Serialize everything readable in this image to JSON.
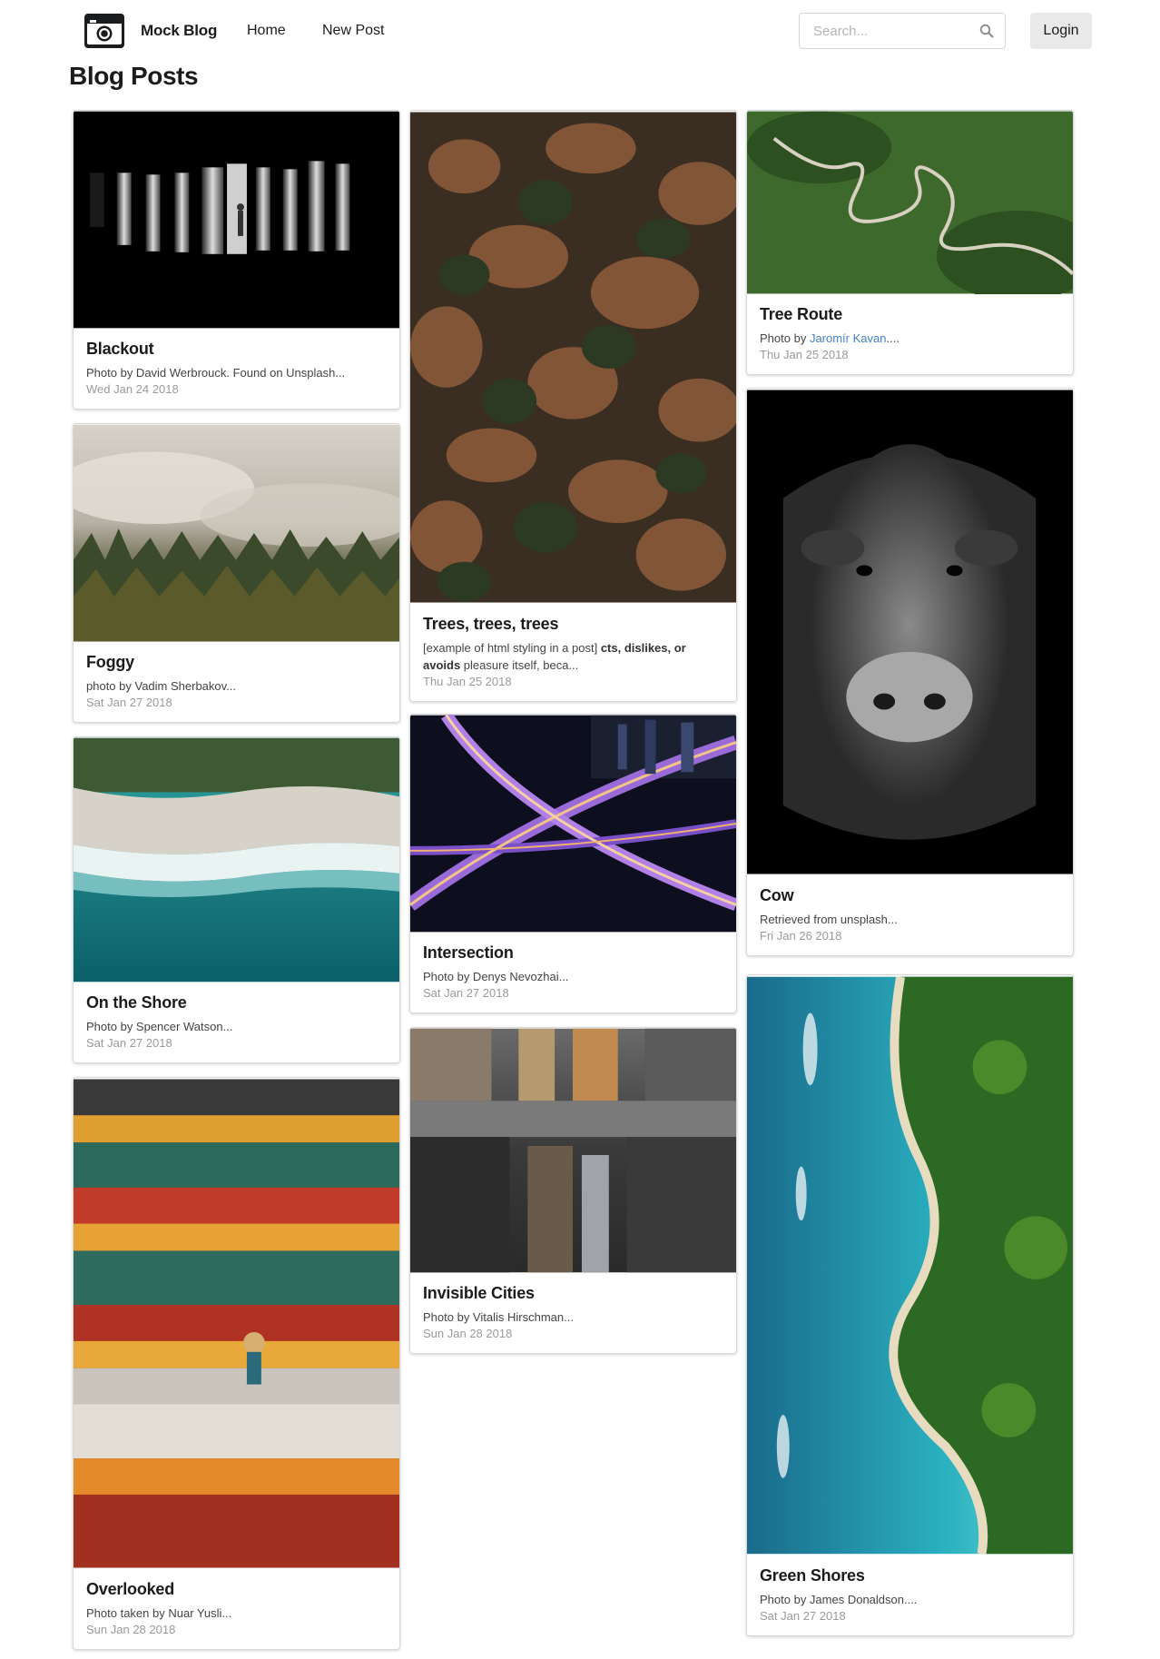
{
  "nav": {
    "brand": "Mock Blog",
    "links": [
      "Home",
      "New Post"
    ],
    "search_placeholder": "Search...",
    "login": "Login"
  },
  "page": {
    "title": "Blog Posts"
  },
  "posts": [
    {
      "title": "Blackout",
      "desc": "Photo by David Werbrouck. Found on Unsplash...",
      "date": "Wed Jan 24 2018",
      "image": "black-white-columns-silhouette"
    },
    {
      "title": "Foggy",
      "desc": "photo by Vadim Sherbakov...",
      "date": "Sat Jan 27 2018",
      "image": "misty-forest"
    },
    {
      "title": "On the Shore",
      "desc": "Photo by Spencer Watson...",
      "date": "Sat Jan 27 2018",
      "image": "aerial-beach-waves"
    },
    {
      "title": "Overlooked",
      "desc": "Photo taken by Nuar Yusli...",
      "date": "Sun Jan 28 2018",
      "image": "temple-balcony-woman"
    },
    {
      "title": "Trees, trees, trees",
      "desc_parts": [
        "[example of html styling in a post] ",
        "cts, dislikes, or avoids",
        " pleasure itself, beca..."
      ],
      "date": "Thu Jan 25 2018",
      "image": "aerial-autumn-forest"
    },
    {
      "title": "Intersection",
      "desc": "Photo by Denys Nevozhai...",
      "date": "Sat Jan 27 2018",
      "image": "night-highway-interchange"
    },
    {
      "title": "Invisible Cities",
      "desc": "Photo by Vitalis Hirschman...",
      "date": "Sun Jan 28 2018",
      "image": "street-reflection-puddle"
    },
    {
      "title": "Tree Route",
      "desc_prefix": "Photo by ",
      "desc_link": "Jaromír Kavan",
      "desc_suffix": "....",
      "date": "Thu Jan 25 2018",
      "image": "winding-road-green-hills"
    },
    {
      "title": "Cow",
      "desc": "Retrieved from unsplash...",
      "date": "Fri Jan 26 2018",
      "image": "black-white-highland-cow"
    },
    {
      "title": "Green Shores",
      "desc": "Photo by James Donaldson....",
      "date": "Sat Jan 27 2018",
      "image": "aerial-turquoise-coast"
    }
  ],
  "colors": {
    "link": "#4183c4",
    "date": "#9a9a9a",
    "title": "#1b1c1d"
  }
}
